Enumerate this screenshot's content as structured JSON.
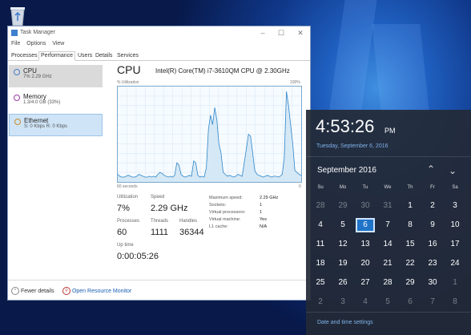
{
  "taskmanager": {
    "title": "Task Manager",
    "menu": [
      "File",
      "Options",
      "View"
    ],
    "tabs": [
      "Processes",
      "Performance",
      "Users",
      "Details",
      "Services"
    ],
    "sidebar": [
      {
        "name": "CPU",
        "sub": "7% 2.29 GHz",
        "color": "#4a7cc4"
      },
      {
        "name": "Memory",
        "sub": "1.3/4.0 GB (33%)",
        "color": "#9a3aa6"
      },
      {
        "name": "Ethernet",
        "sub": "S: 0 Kbps R: 0 Kbps",
        "color": "#c98d2b"
      }
    ],
    "cpu": {
      "heading": "CPU",
      "model": "Intel(R) Core(TM) i7-3610QM CPU @ 2.30GHz",
      "graph_label": "% Utilization",
      "graph_max": "100%",
      "graph_time": "60 seconds",
      "graph_min": "0",
      "stats": {
        "utilization_label": "Utilization",
        "utilization": "7%",
        "speed_label": "Speed",
        "speed": "2.29 GHz",
        "processes_label": "Processes",
        "processes": "60",
        "threads_label": "Threads",
        "threads": "1111",
        "handles_label": "Handles",
        "handles": "36344",
        "uptime_label": "Up time",
        "uptime": "0:00:05:26"
      },
      "details": [
        {
          "k": "Maximum speed:",
          "v": "2.29 GHz"
        },
        {
          "k": "Sockets:",
          "v": "1"
        },
        {
          "k": "Virtual processors:",
          "v": "1"
        },
        {
          "k": "Virtual machine:",
          "v": "Yes"
        },
        {
          "k": "L1 cache:",
          "v": "N/A"
        }
      ],
      "utilization_history": [
        8,
        6,
        5,
        5,
        6,
        7,
        6,
        5,
        5,
        6,
        8,
        7,
        6,
        5,
        5,
        6,
        5,
        6,
        5,
        8,
        10,
        9,
        7,
        6,
        5,
        6,
        5,
        7,
        20,
        18,
        8,
        6,
        5,
        6,
        7,
        6,
        22,
        20,
        7,
        5,
        6,
        5,
        15,
        55,
        70,
        60,
        78,
        65,
        40,
        30,
        10,
        8,
        6,
        7,
        6,
        5,
        6,
        8,
        7,
        6,
        20,
        35,
        50,
        48,
        30,
        12,
        8,
        7,
        6,
        5,
        6,
        7,
        6,
        5,
        6,
        6,
        5,
        6,
        8,
        25,
        95,
        80,
        60,
        40,
        12,
        10,
        8,
        7
      ]
    },
    "footer": {
      "fewer": "Fewer details",
      "monitor": "Open Resource Monitor"
    }
  },
  "clock": {
    "time": "4:53:26",
    "ampm": "PM",
    "date": "Tuesday, September 6, 2016",
    "month": "September 2016",
    "weekdays": [
      "Su",
      "Mo",
      "Tu",
      "We",
      "Th",
      "Fr",
      "Sa"
    ],
    "weeks": [
      [
        "28",
        "29",
        "30",
        "31",
        "1",
        "2",
        "3"
      ],
      [
        "4",
        "5",
        "6",
        "7",
        "8",
        "9",
        "10"
      ],
      [
        "11",
        "12",
        "13",
        "14",
        "15",
        "16",
        "17"
      ],
      [
        "18",
        "19",
        "20",
        "21",
        "22",
        "23",
        "24"
      ],
      [
        "25",
        "26",
        "27",
        "28",
        "29",
        "30",
        "1"
      ],
      [
        "2",
        "3",
        "4",
        "5",
        "6",
        "7",
        "8"
      ]
    ],
    "today": "6",
    "settings_link": "Date and time settings"
  }
}
